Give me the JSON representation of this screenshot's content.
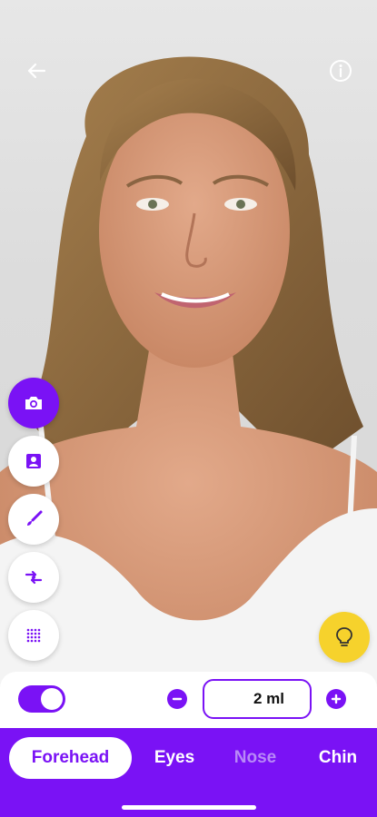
{
  "nav": {
    "back_icon": "arrow-left-icon",
    "info_icon": "info-circle-icon"
  },
  "tools": [
    {
      "name": "camera",
      "icon": "camera-icon",
      "active": true
    },
    {
      "name": "portrait",
      "icon": "portrait-icon",
      "active": false
    },
    {
      "name": "brush",
      "icon": "brush-icon",
      "active": false
    },
    {
      "name": "compare",
      "icon": "compare-arrows-icon",
      "active": false
    },
    {
      "name": "grid",
      "icon": "dot-grid-icon",
      "active": false
    }
  ],
  "tip_button": {
    "icon": "lightbulb-icon",
    "color": "#f6d22c"
  },
  "controls": {
    "toggle_on": true,
    "dose_value": "2 ml",
    "minus_icon": "minus-circle-icon",
    "plus_icon": "plus-circle-icon"
  },
  "areas": [
    {
      "label": "Forehead",
      "state": "selected"
    },
    {
      "label": "Eyes",
      "state": "normal"
    },
    {
      "label": "Nose",
      "state": "disabled"
    },
    {
      "label": "Chin",
      "state": "normal"
    }
  ],
  "colors": {
    "accent": "#7a12f5",
    "tip": "#f6d22c",
    "disabled_tab": "#b889f7"
  }
}
